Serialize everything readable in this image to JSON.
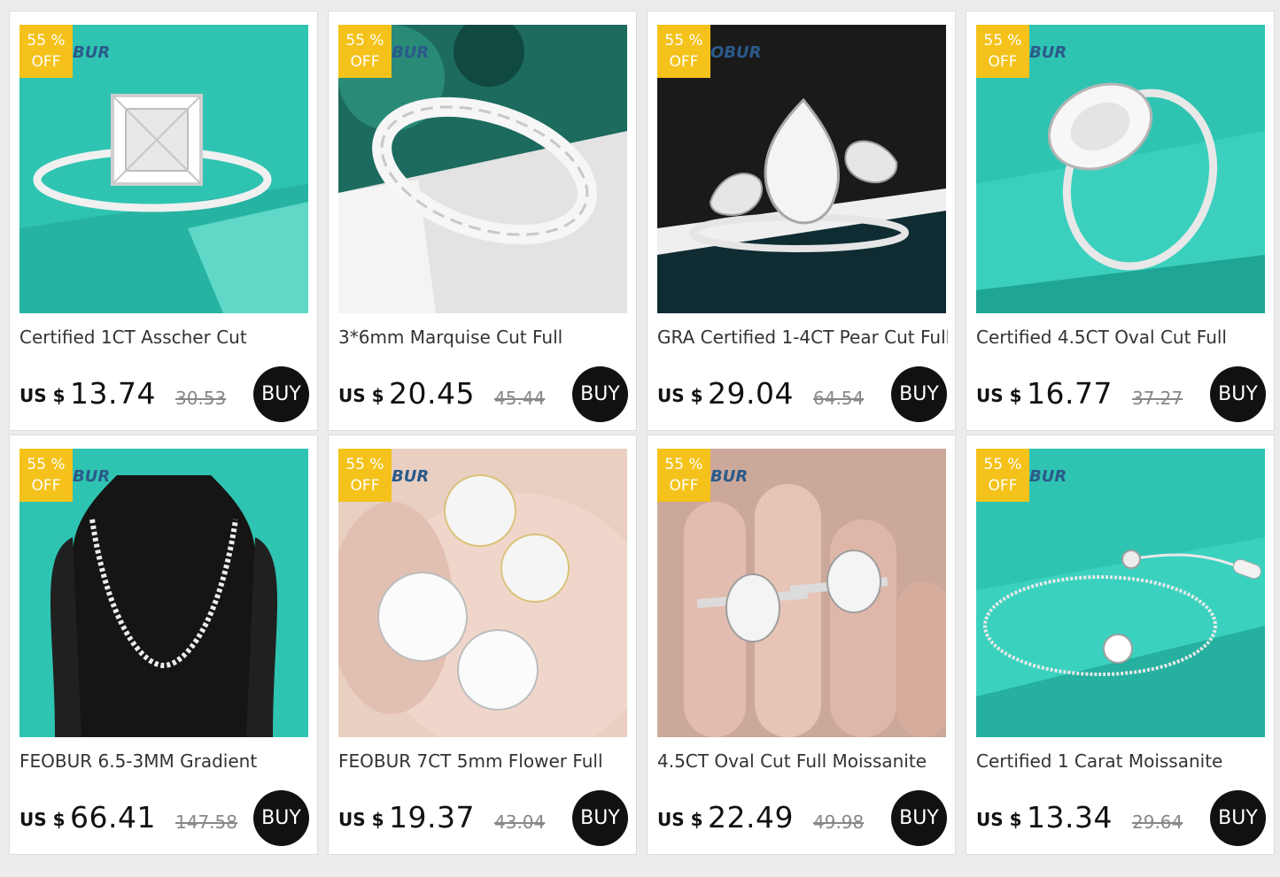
{
  "products": [
    {
      "title": "Certified 1CT Asscher Cut",
      "currency": "US $",
      "price": "13.74",
      "original_price": "30.53",
      "discount_top": "55 %",
      "discount_bottom": "OFF",
      "brand": "BUR",
      "buy_label": "BUY",
      "bg": "#2fc4b2",
      "image": "asscher-ring"
    },
    {
      "title": "3*6mm Marquise Cut Full",
      "currency": "US $",
      "price": "20.45",
      "original_price": "45.44",
      "discount_top": "55 %",
      "discount_bottom": "OFF",
      "brand": "BUR",
      "buy_label": "BUY",
      "bg": "#1c6b5e",
      "image": "marquise-band"
    },
    {
      "title": "GRA Certified 1-4CT Pear Cut Full",
      "currency": "US $",
      "price": "29.04",
      "original_price": "64.54",
      "discount_top": "55 %",
      "discount_bottom": "OFF",
      "brand": "OBUR",
      "buy_label": "BUY",
      "bg": "#1a1a1a",
      "image": "pear-ring"
    },
    {
      "title": "Certified 4.5CT Oval Cut Full",
      "currency": "US $",
      "price": "16.77",
      "original_price": "37.27",
      "discount_top": "55 %",
      "discount_bottom": "OFF",
      "brand": "BUR",
      "buy_label": "BUY",
      "bg": "#2fc4b2",
      "image": "oval-ring"
    },
    {
      "title": "FEOBUR 6.5-3MM Gradient",
      "currency": "US $",
      "price": "66.41",
      "original_price": "147.58",
      "discount_top": "55 %",
      "discount_bottom": "OFF",
      "brand": "BUR",
      "buy_label": "BUY",
      "bg": "#2fc4b2",
      "image": "tennis-necklace"
    },
    {
      "title": "FEOBUR 7CT 5mm Flower Full",
      "currency": "US $",
      "price": "19.37",
      "original_price": "43.04",
      "discount_top": "55 %",
      "discount_bottom": "OFF",
      "brand": "BUR",
      "buy_label": "BUY",
      "bg": "#e9cfc2",
      "image": "flower-earrings"
    },
    {
      "title": "4.5CT Oval Cut Full Moissanite",
      "currency": "US $",
      "price": "22.49",
      "original_price": "49.98",
      "discount_top": "55 %",
      "discount_bottom": "OFF",
      "brand": "BUR",
      "buy_label": "BUY",
      "bg": "#cba89a",
      "image": "rings-on-hand"
    },
    {
      "title": "Certified 1 Carat Moissanite",
      "currency": "US $",
      "price": "13.34",
      "original_price": "29.64",
      "discount_top": "55 %",
      "discount_bottom": "OFF",
      "brand": "BUR",
      "buy_label": "BUY",
      "bg": "#2fc4b2",
      "image": "solitaire-bracelet"
    }
  ]
}
